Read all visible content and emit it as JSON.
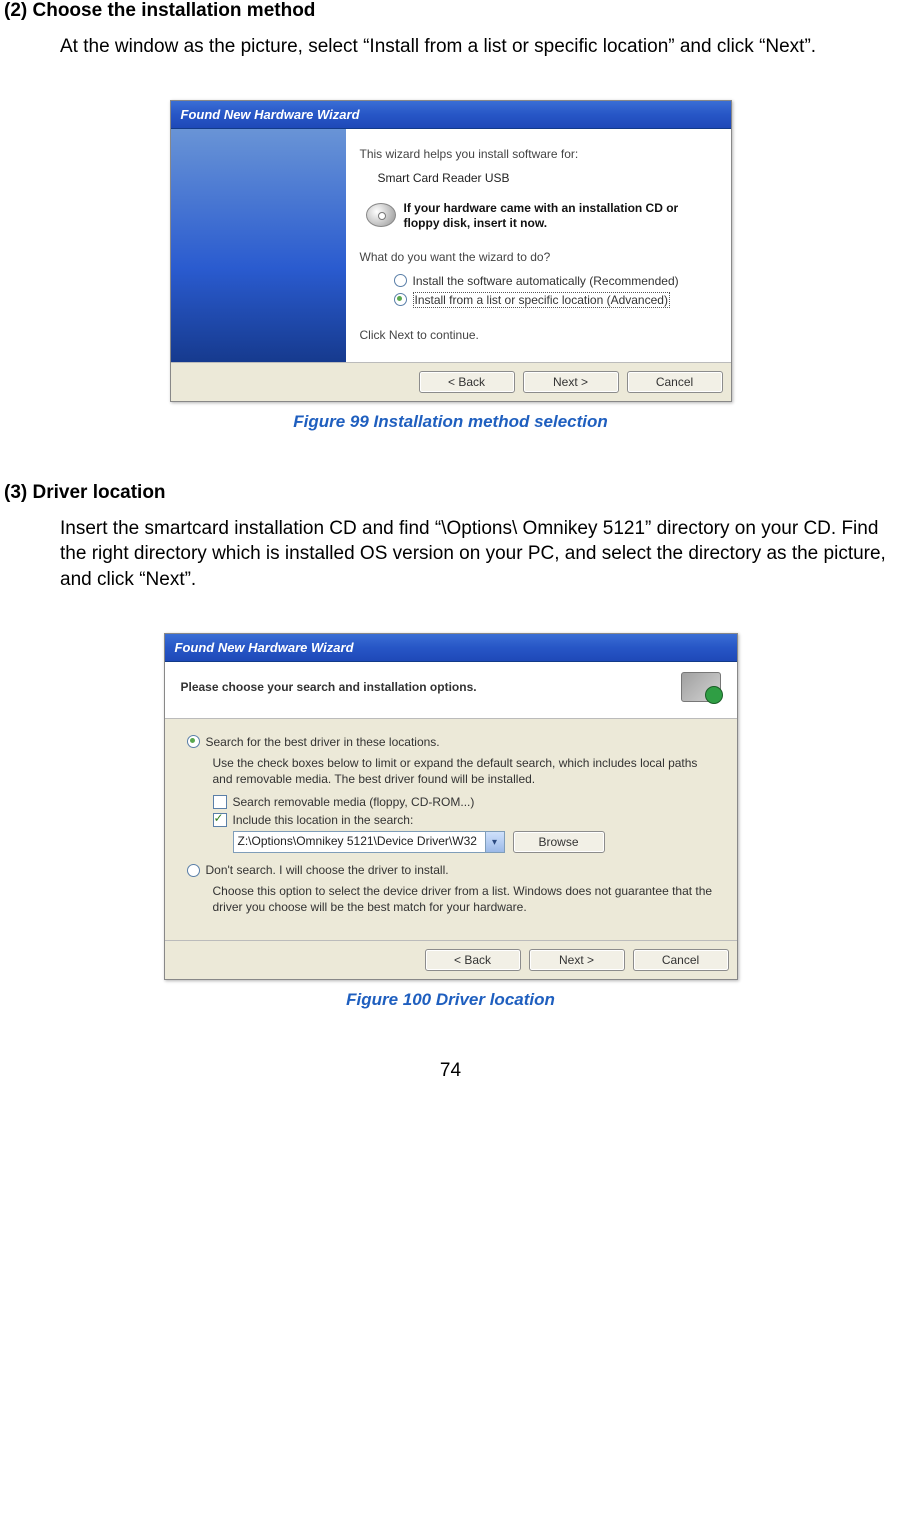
{
  "section2": {
    "heading": "(2) Choose the installation method",
    "body": "At the window as the picture, select “Install from a list or specific location” and click “Next”."
  },
  "figure99": {
    "caption": "Figure 99 Installation method selection",
    "window": {
      "title": "Found New Hardware Wizard",
      "intro": "This wizard helps you install software for:",
      "device": "Smart Card Reader USB",
      "cd_text": "If your hardware came with an installation CD or floppy disk, insert it now.",
      "question": "What do you want the wizard to do?",
      "option_auto": "Install the software automatically (Recommended)",
      "option_list": "Install from a list or specific location (Advanced)",
      "click_next": "Click Next to continue.",
      "btn_back": "< Back",
      "btn_next": "Next >",
      "btn_cancel": "Cancel"
    }
  },
  "section3": {
    "heading": "(3) Driver location",
    "body": "Insert the smartcard installation CD and find “\\Options\\ Omnikey 5121” directory on your CD. Find the right directory which is installed OS version on your PC, and select the directory as the picture, and click “Next”."
  },
  "figure100": {
    "caption": "Figure 100 Driver location",
    "window": {
      "title": "Found New Hardware Wizard",
      "header": "Please choose your search and installation options.",
      "opt_search": "Search for the best driver in these locations.",
      "search_help": "Use the check boxes below to limit or expand the default search, which includes local paths and removable media. The best driver found will be installed.",
      "chk_media": "Search removable media (floppy, CD-ROM...)",
      "chk_include": "Include this location in the search:",
      "path": "Z:\\Options\\Omnikey 5121\\Device Driver\\W32",
      "browse": "Browse",
      "opt_dont": "Don't search. I will choose the driver to install.",
      "dont_help": "Choose this option to select the device driver from a list. Windows does not guarantee that the driver you choose will be the best match for your hardware.",
      "btn_back": "< Back",
      "btn_next": "Next >",
      "btn_cancel": "Cancel"
    }
  },
  "page_number": "74"
}
